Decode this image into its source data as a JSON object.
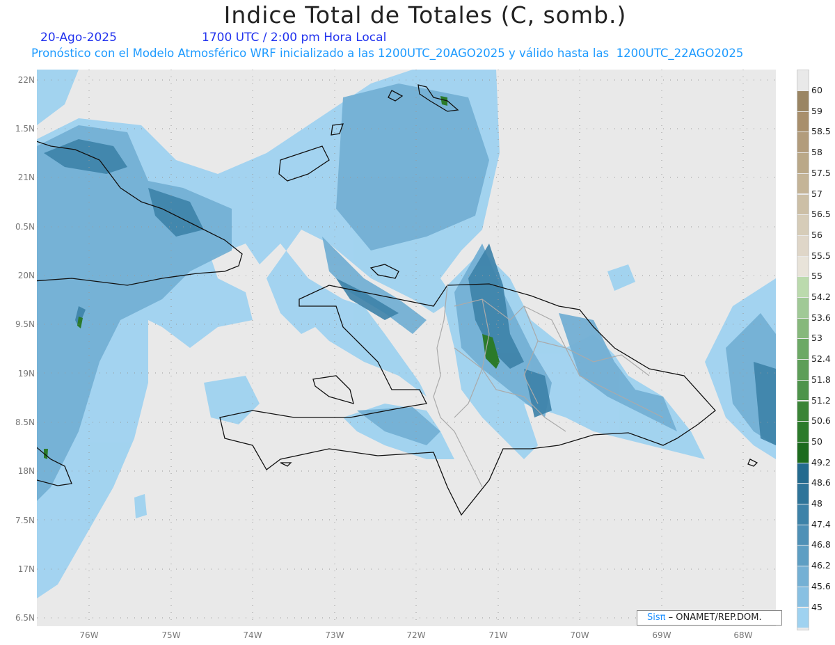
{
  "title": "Indice Total de Totales (C, somb.)",
  "date": "20-Ago-2025",
  "time": "1700 UTC / 2:00 pm Hora Local",
  "subtitle": "Pronóstico con el Modelo Atmosférico WRF inicializado a las 1200UTC_20AGO2025 y válido hasta las  1200UTC_22AGO2025",
  "lat_labels": [
    "22N",
    "1.5N",
    "21N",
    "0.5N",
    "20N",
    "9.5N",
    "19N",
    "8.5N",
    "18N",
    "7.5N",
    "17N",
    "6.5N"
  ],
  "lon_labels": [
    "76W",
    "75W",
    "74W",
    "73W",
    "72W",
    "71W",
    "70W",
    "69W",
    "68W"
  ],
  "colorbar": {
    "labels": [
      "60",
      "59",
      "58.5",
      "58",
      "57.5",
      "57",
      "56.5",
      "56",
      "55.5",
      "55",
      "54.2",
      "53.6",
      "53",
      "52.4",
      "51.8",
      "51.2",
      "50.6",
      "50",
      "49.2",
      "48.6",
      "48",
      "47.4",
      "46.8",
      "46.2",
      "45.6",
      "45"
    ],
    "colors": [
      "#9a8563",
      "#a88f6c",
      "#b29c7c",
      "#baa888",
      "#c4b497",
      "#ccbfa6",
      "#d6ccb8",
      "#dfd6c8",
      "#e8e3d9",
      "#bbdaad",
      "#a0c996",
      "#86b87b",
      "#6ca965",
      "#5d9e58",
      "#4d934a",
      "#3a8436",
      "#2b7a2a",
      "#1c6b1e",
      "#236a8e",
      "#2e7499",
      "#3d82a8",
      "#4e90b6",
      "#5d9ec3",
      "#74b0d4",
      "#88c0e2",
      "#9fd2f0"
    ]
  },
  "credit": {
    "brand": "Sisπ",
    "text": " – ONAMET/REP.DOM."
  }
}
